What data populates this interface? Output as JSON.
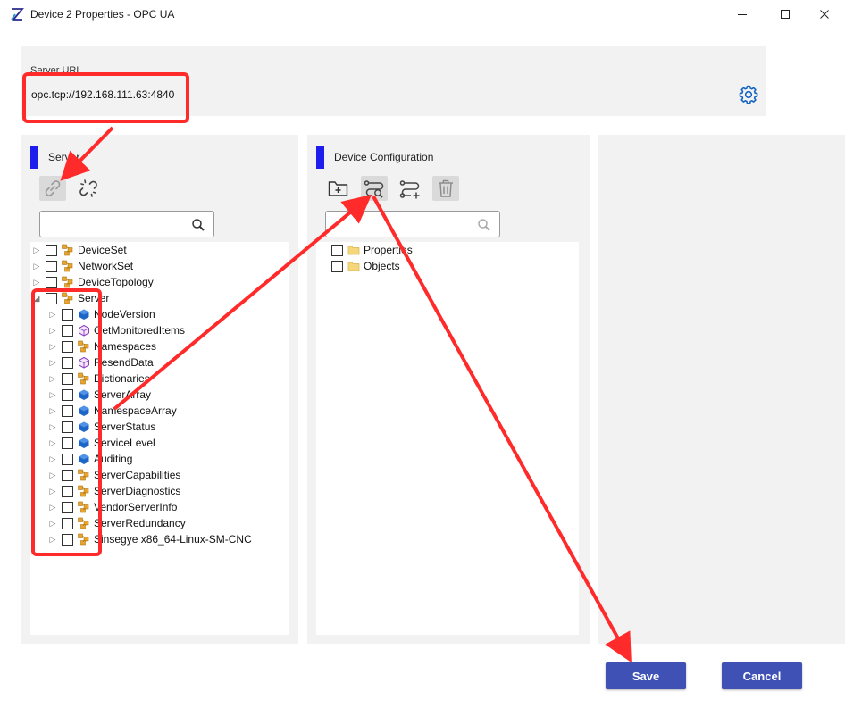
{
  "window": {
    "title": "Device 2 Properties - OPC UA",
    "logo_icon": "app-logo-icon",
    "controls": [
      "minimize-icon",
      "maximize-icon",
      "close-icon"
    ]
  },
  "server_url": {
    "label": "Server URL",
    "value": "opc.tcp://192.168.111.63:4840"
  },
  "server_panel": {
    "title": "Server",
    "toolbar": [
      "link-icon",
      "unlink-icon"
    ],
    "search_value": "",
    "tree": [
      {
        "label": "DeviceSet",
        "icon": "object-icon",
        "expanded": false,
        "depth": 0
      },
      {
        "label": "NetworkSet",
        "icon": "object-icon",
        "expanded": false,
        "depth": 0
      },
      {
        "label": "DeviceTopology",
        "icon": "object-icon",
        "expanded": false,
        "depth": 0
      },
      {
        "label": "Server",
        "icon": "object-icon",
        "expanded": true,
        "depth": 0
      },
      {
        "label": "NodeVersion",
        "icon": "variable-icon",
        "expanded": false,
        "depth": 1
      },
      {
        "label": "GetMonitoredItems",
        "icon": "method-icon",
        "expanded": false,
        "depth": 1
      },
      {
        "label": "Namespaces",
        "icon": "object-icon",
        "expanded": false,
        "depth": 1
      },
      {
        "label": "ResendData",
        "icon": "method-icon",
        "expanded": false,
        "depth": 1
      },
      {
        "label": "Dictionaries",
        "icon": "object-icon",
        "expanded": false,
        "depth": 1
      },
      {
        "label": "ServerArray",
        "icon": "variable-icon",
        "expanded": false,
        "depth": 1
      },
      {
        "label": "NamespaceArray",
        "icon": "variable-icon",
        "expanded": false,
        "depth": 1
      },
      {
        "label": "ServerStatus",
        "icon": "variable-icon",
        "expanded": false,
        "depth": 1
      },
      {
        "label": "ServiceLevel",
        "icon": "variable-icon",
        "expanded": false,
        "depth": 1
      },
      {
        "label": "Auditing",
        "icon": "variable-icon",
        "expanded": false,
        "depth": 1
      },
      {
        "label": "ServerCapabilities",
        "icon": "object-icon",
        "expanded": false,
        "depth": 1
      },
      {
        "label": "ServerDiagnostics",
        "icon": "object-icon",
        "expanded": false,
        "depth": 1
      },
      {
        "label": "VendorServerInfo",
        "icon": "object-icon",
        "expanded": false,
        "depth": 1
      },
      {
        "label": "ServerRedundancy",
        "icon": "object-icon",
        "expanded": false,
        "depth": 1
      },
      {
        "label": "Sinsegye x86_64-Linux-SM-CNC",
        "icon": "object-icon",
        "expanded": false,
        "depth": 1
      }
    ]
  },
  "device_panel": {
    "title": "Device Configuration",
    "toolbar": [
      "add-folder-icon",
      "map-node-icon",
      "add-node-icon",
      "delete-icon"
    ],
    "search_value": "",
    "tree": [
      {
        "label": "Properties",
        "icon": "folder-icon"
      },
      {
        "label": "Objects",
        "icon": "folder-icon"
      }
    ]
  },
  "colors": {
    "accent_bar": "#1d1dee",
    "button": "#3f51b5",
    "panel": "#f2f2f2",
    "annotation": "#ff2a2a"
  },
  "buttons": {
    "save": "Save",
    "cancel": "Cancel"
  }
}
